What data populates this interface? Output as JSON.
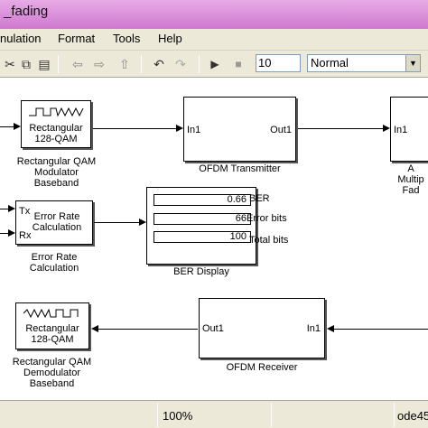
{
  "window": {
    "title": "_fading"
  },
  "menu": {
    "simulation": "nulation",
    "format": "Format",
    "tools": "Tools",
    "help": "Help"
  },
  "toolbar": {
    "stop_time": "10",
    "sim_mode": "Normal"
  },
  "blocks": {
    "modulator": {
      "port_label": "Rectangular\n128-QAM",
      "name": "Rectangular QAM\nModulator\nBaseband"
    },
    "ofdm_tx": {
      "in": "In1",
      "out": "Out1",
      "name": "OFDM Transmitter"
    },
    "awgn": {
      "in": "In1",
      "name": "A\nMultip\nFad"
    },
    "err_calc": {
      "tx": "Tx",
      "rx": "Rx",
      "inner": "Error Rate\nCalculation",
      "name": "Error Rate\nCalculation"
    },
    "ber_display": {
      "name": "BER Display",
      "values": [
        "0.66",
        "66",
        "100"
      ],
      "labels": [
        "BER",
        "Error bits",
        "Total bits"
      ]
    },
    "ofdm_rx": {
      "out": "Out1",
      "in": "In1",
      "name": "OFDM Receiver"
    },
    "demodulator": {
      "port_label": "Rectangular\n128-QAM",
      "name": "Rectangular QAM\nDemodulator\nBaseband"
    }
  },
  "status": {
    "zoom": "100%",
    "solver": "ode45"
  }
}
